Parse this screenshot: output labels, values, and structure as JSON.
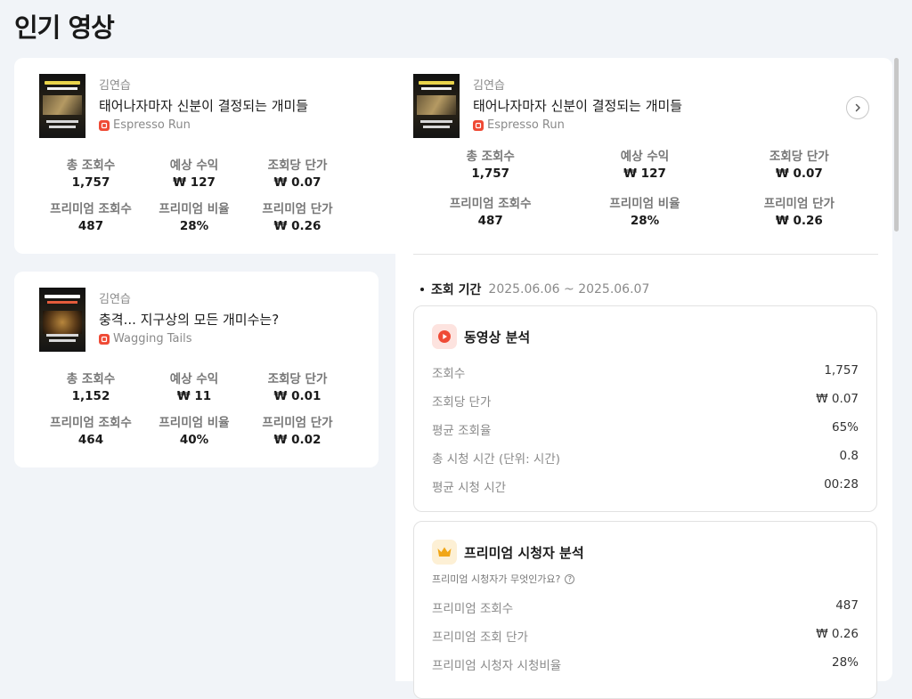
{
  "page_title": "인기 영상",
  "stat_labels": {
    "total_views": "총 조회수",
    "est_revenue": "예상 수익",
    "cost_per_view": "조회당 단가",
    "premium_views": "프리미엄 조회수",
    "premium_ratio": "프리미엄 비율",
    "premium_price": "프리미엄 단가"
  },
  "videos": [
    {
      "author": "김연습",
      "title": "태어나자마자 신분이 결정되는 개미들",
      "channel": "Espresso Run",
      "total_views": "1,757",
      "est_revenue": "₩ 127",
      "cost_per_view": "₩ 0.07",
      "premium_views": "487",
      "premium_ratio": "28%",
      "premium_price": "₩ 0.26"
    },
    {
      "author": "김연습",
      "title": "충격... 지구상의 모든 개미수는?",
      "channel": "Wagging Tails",
      "total_views": "1,152",
      "est_revenue": "₩ 11",
      "cost_per_view": "₩ 0.01",
      "premium_views": "464",
      "premium_ratio": "40%",
      "premium_price": "₩ 0.02"
    }
  ],
  "detail": {
    "author": "김연습",
    "title": "태어나자마자 신분이 결정되는 개미들",
    "channel": "Espresso Run",
    "total_views": "1,757",
    "est_revenue": "₩ 127",
    "cost_per_view": "₩ 0.07",
    "premium_views": "487",
    "premium_ratio": "28%",
    "premium_price": "₩ 0.26",
    "period_label": "조회 기간",
    "period_range": "2025.06.06 ~ 2025.06.07",
    "video_analysis": {
      "title": "동영상 분석",
      "rows": [
        {
          "k": "조회수",
          "v": "1,757"
        },
        {
          "k": "조회당 단가",
          "v": "₩ 0.07"
        },
        {
          "k": "평균 조회율",
          "v": "65%"
        },
        {
          "k": "총 시청 시간 (단위: 시간)",
          "v": "0.8"
        },
        {
          "k": "평균 시청 시간",
          "v": "00:28"
        }
      ]
    },
    "premium_analysis": {
      "title": "프리미엄 시청자 분석",
      "subtitle": "프리미엄 시청자가 무엇인가요?",
      "help_glyph": "?",
      "rows": [
        {
          "k": "프리미엄 조회수",
          "v": "487"
        },
        {
          "k": "프리미엄 조회 단가",
          "v": "₩ 0.26"
        },
        {
          "k": "프리미엄 시청자 시청비율",
          "v": "28%"
        }
      ]
    }
  },
  "colors": {
    "background": "#f1f4f8",
    "card": "#ffffff",
    "channel_icon": "#ef4a35",
    "video_icon_bg": "#fde3df",
    "video_icon": "#ef4a35",
    "premium_icon_bg": "#fdf0d5",
    "premium_icon": "#f1a617"
  },
  "icons": {
    "channel": "channel-logo-icon",
    "next": "chevron-right-icon",
    "video_analysis": "play-circle-icon",
    "premium": "crown-icon",
    "help": "question-circle-icon"
  }
}
